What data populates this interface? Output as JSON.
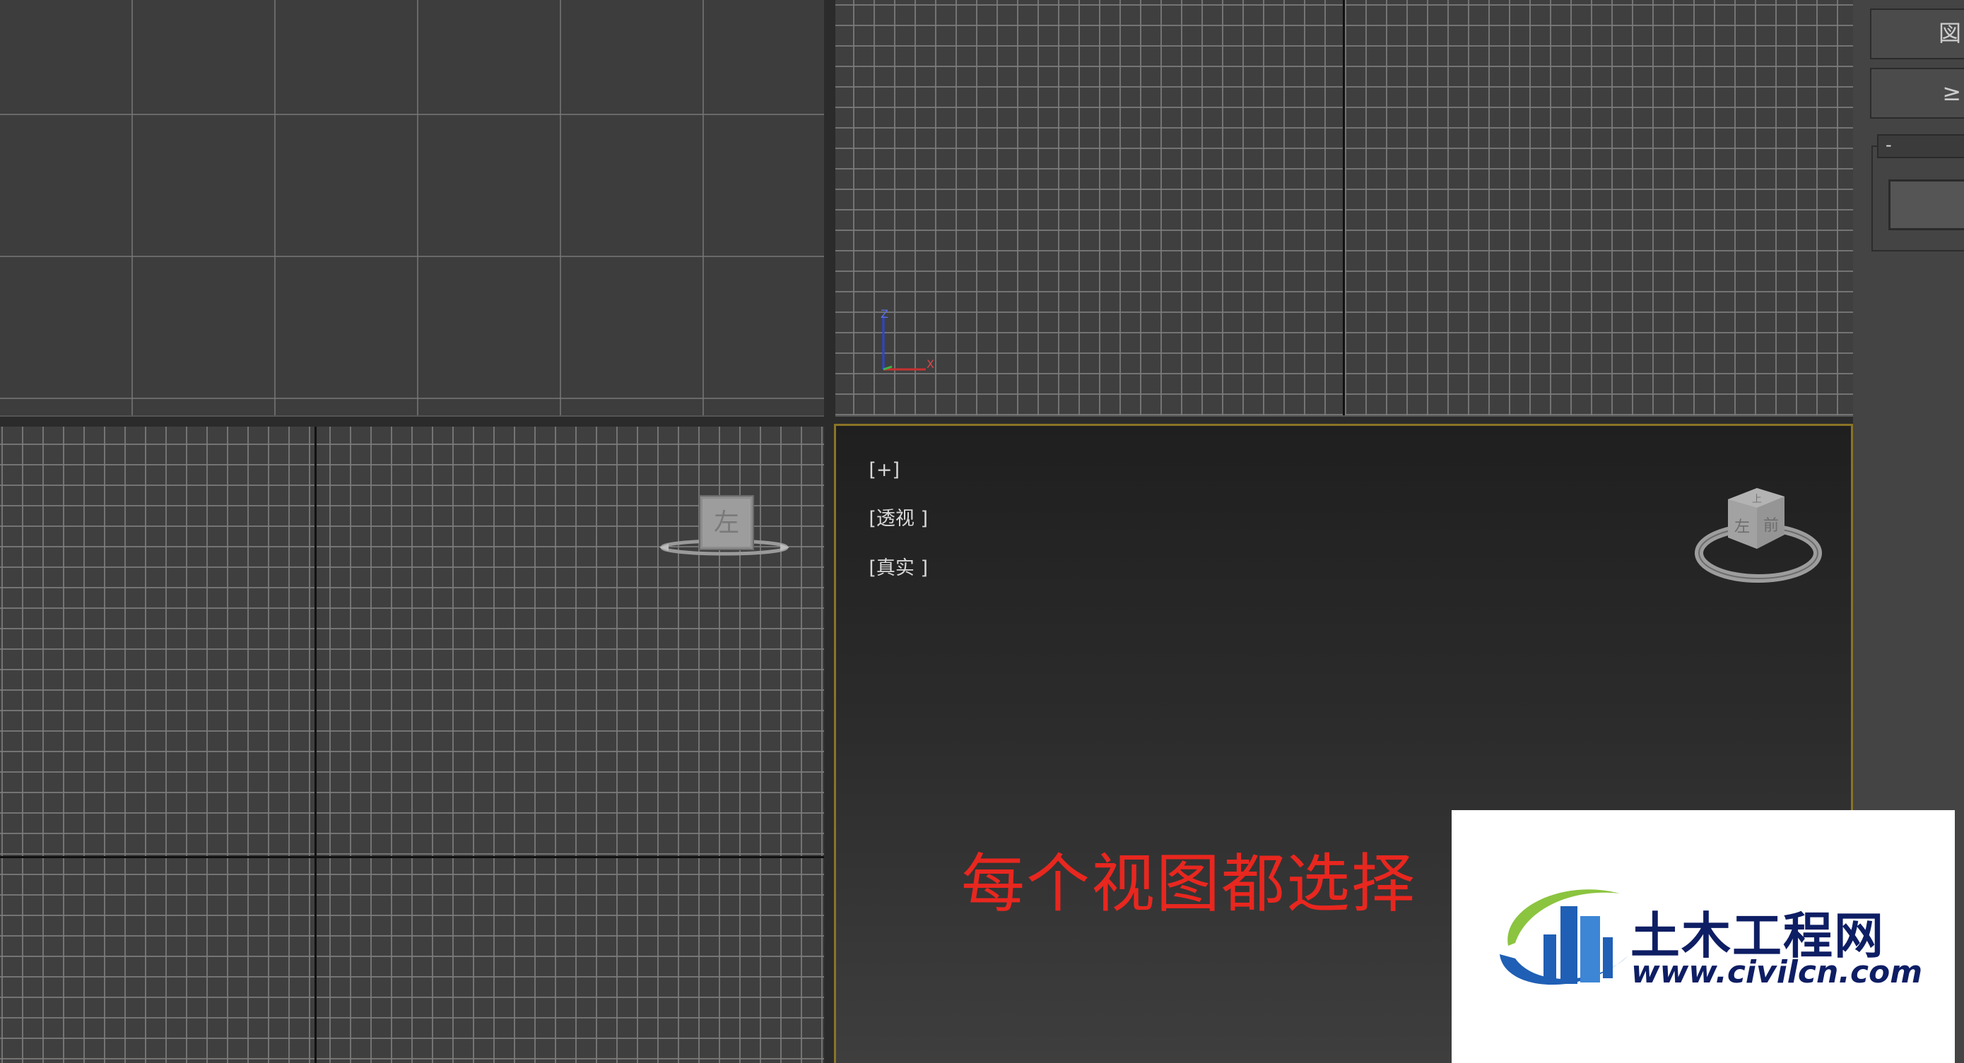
{
  "viewports": {
    "top": {
      "label": ""
    },
    "front": {
      "axis_z": "Z",
      "axis_x": "X"
    },
    "left": {
      "viewcube_face": "左"
    },
    "perspective": {
      "label_plus": "[+]",
      "label_view": "[透视 ]",
      "label_shading": "[真实 ]",
      "viewcube_face_left": "左",
      "viewcube_face_front": "前",
      "viewcube_face_top": "上"
    }
  },
  "annotation": {
    "text": "每个视图都选择"
  },
  "sidebar": {
    "btn1_label": "図",
    "btn2_label": "≥",
    "field_value": "-"
  },
  "watermark": {
    "name": "土木工程网",
    "url": "www.civilcn.com"
  },
  "colors": {
    "viewport_bg": "#3f3f3f",
    "grid_line": "#7d7d7d",
    "active_border": "#8a7425",
    "annotation_red": "#e8271f",
    "watermark_blue": "#0e1e64",
    "logo_green": "#8bc43f",
    "logo_blue": "#1f5fb5"
  }
}
